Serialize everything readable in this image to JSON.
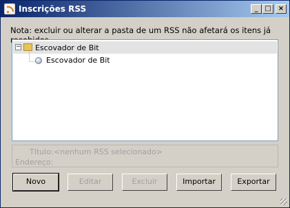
{
  "window": {
    "title": "Inscrições RSS"
  },
  "titlebar_buttons": {
    "minimize": "_",
    "maximize": "□",
    "close": "×"
  },
  "note": "Nota: excluir ou alterar a pasta de um RSS não afetará os itens já recebidos.",
  "tree": {
    "folder": {
      "label": "Escovador de Bit",
      "expander": "−",
      "selected": true
    },
    "feeds": [
      {
        "label": "Escovador de Bit"
      }
    ]
  },
  "details": {
    "title_label": "Título:",
    "title_value": "<nenhum RSS selecionado>",
    "address_label": "Endereço:",
    "address_value": ""
  },
  "buttons": {
    "new": "Novo",
    "edit": "Editar",
    "delete": "Excluir",
    "import": "Importar",
    "export": "Exportar"
  }
}
